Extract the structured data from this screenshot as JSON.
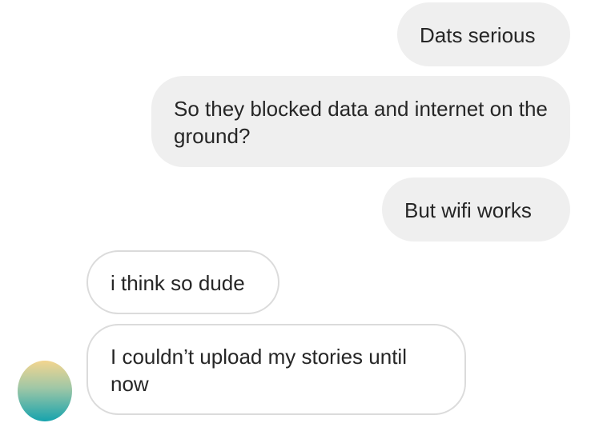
{
  "messages": [
    {
      "sender": "me",
      "text": "Dats serious"
    },
    {
      "sender": "me",
      "text": "So they blocked data and internet on the ground?"
    },
    {
      "sender": "me",
      "text": "But wifi works"
    },
    {
      "sender": "other",
      "text": "i think so dude"
    },
    {
      "sender": "other",
      "text": "I couldn’t upload my stories until now"
    }
  ],
  "colors": {
    "sent_bubble": "#efefef",
    "received_border": "#dbdbdb",
    "text": "#262626"
  },
  "avatar": {
    "icon": "profile-avatar"
  }
}
